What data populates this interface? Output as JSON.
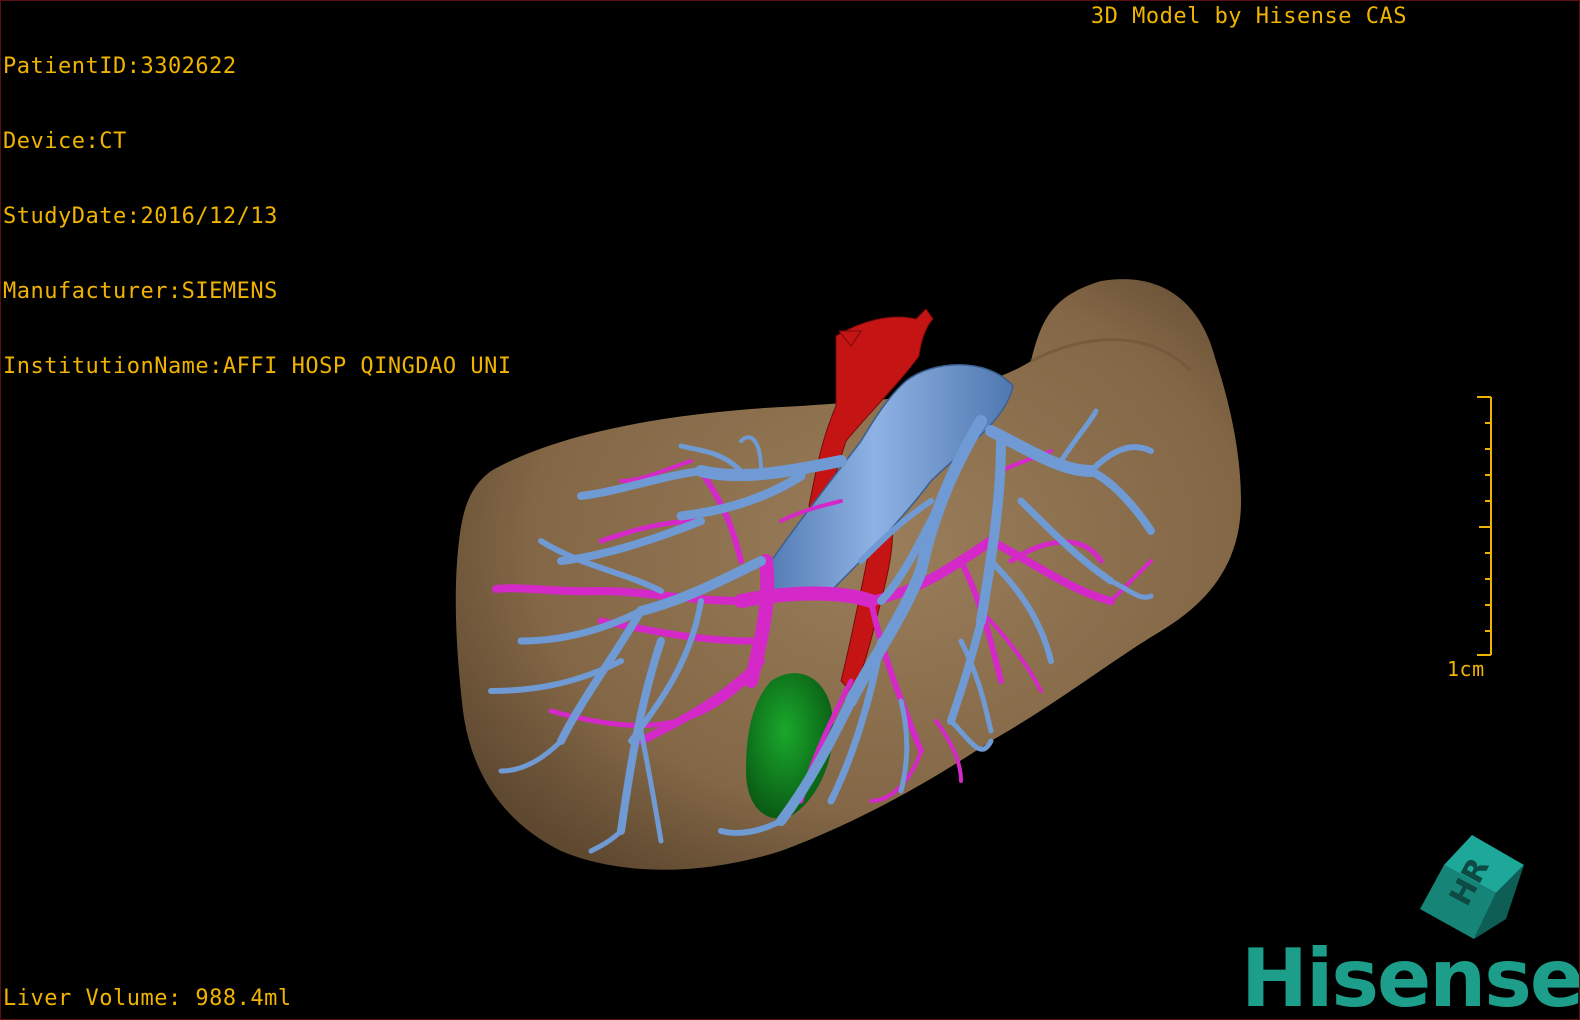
{
  "overlay": {
    "patient_id": "PatientID:3302622",
    "device": "Device:CT",
    "study_date": "StudyDate:2016/12/13",
    "manufacturer": "Manufacturer:SIEMENS",
    "institution": "InstitutionName:AFFI HOSP QINGDAO UNI",
    "brand_text": "3D Model by Hisense CAS",
    "liver_volume": "Liver Volume: 988.4ml"
  },
  "scale_bar": {
    "label": "1cm"
  },
  "orientation_cube": {
    "face_label": "HR",
    "icon": "orientation-cube-icon"
  },
  "logo": {
    "text": "Hisense"
  },
  "colors": {
    "overlay_text": "#f0b400",
    "liver": "#8a6e4e",
    "portal_vein": "#6f9ad4",
    "hepatic_artery": "#d428c8",
    "vena_cava": "#c41414",
    "gallbladder": "#0f8a1e",
    "brand": "#1c9e8a"
  }
}
